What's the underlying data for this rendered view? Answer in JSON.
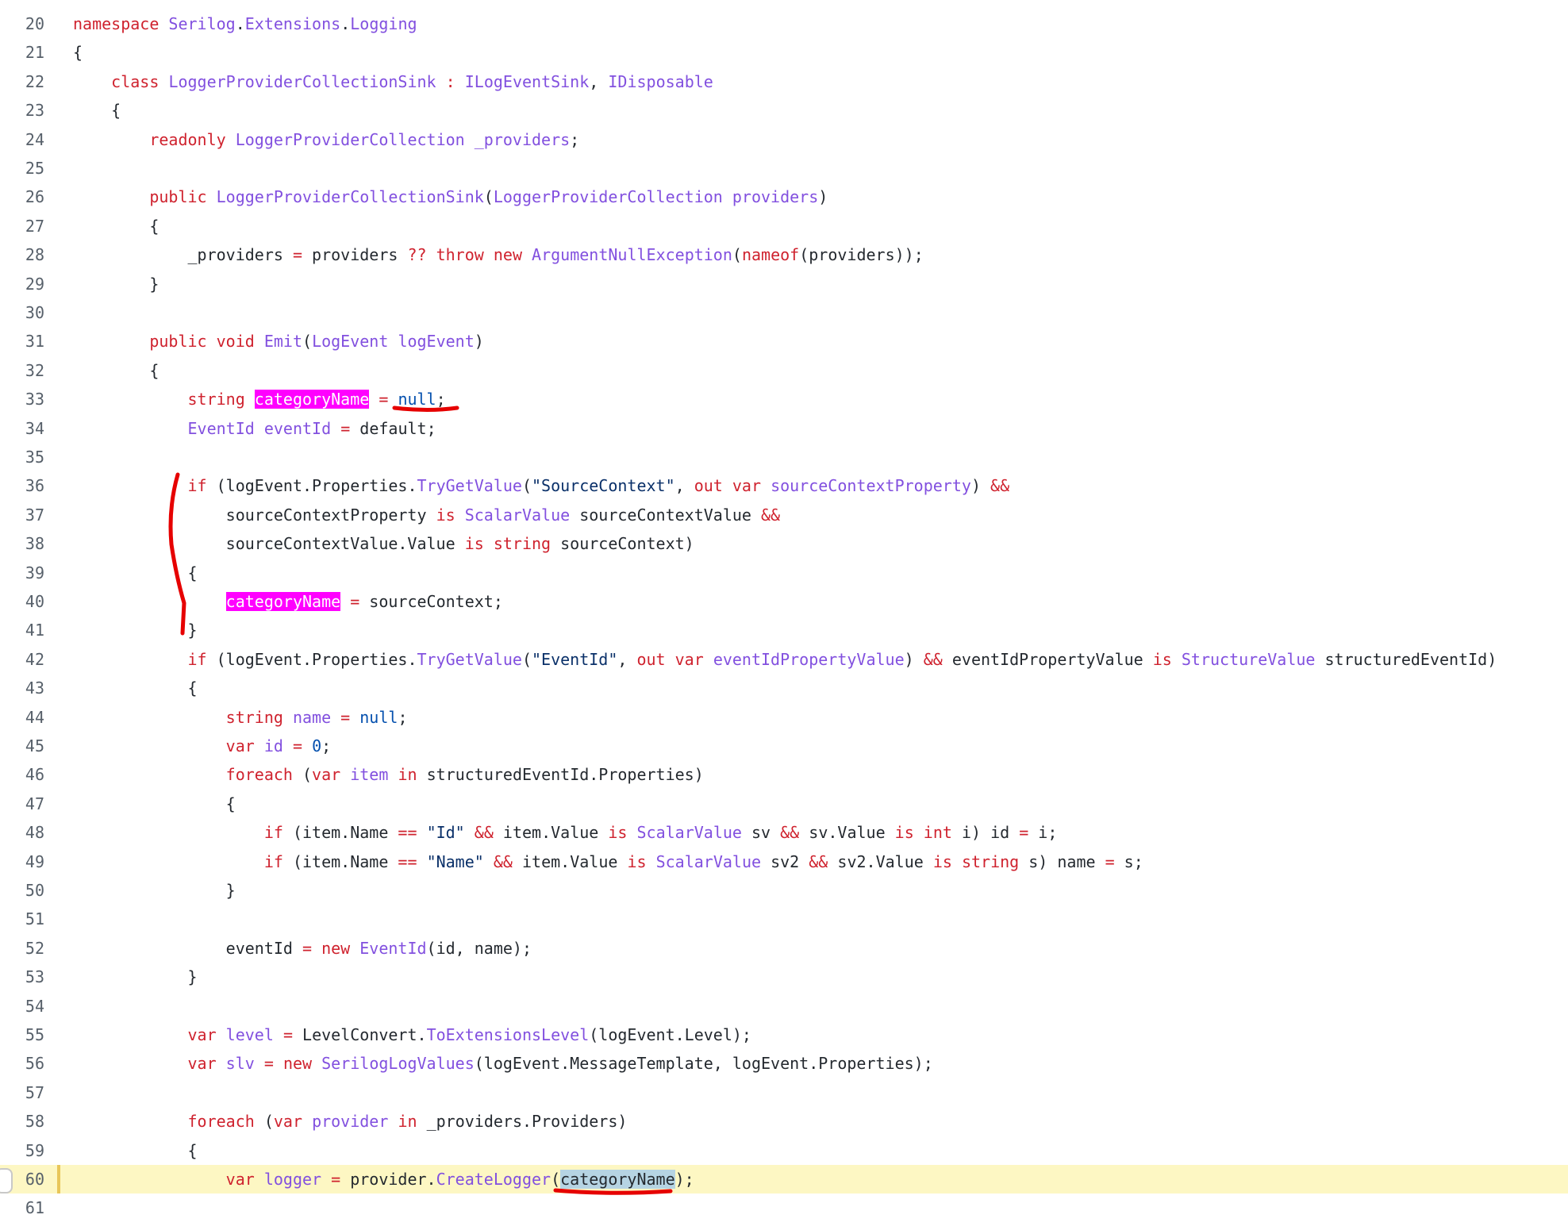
{
  "editor": {
    "active_line": "60",
    "colors": {
      "keyword": "#cf222e",
      "type": "#8250df",
      "string": "#0a3069",
      "literal": "#0550ae",
      "highlight": "#ff00ff",
      "active_line_bg": "#fdf7c3",
      "annotation": "#e60000"
    },
    "lines": [
      {
        "n": "20",
        "t": [
          [
            "kw",
            "namespace"
          ],
          [
            "p",
            " "
          ],
          [
            "ty",
            "Serilog"
          ],
          [
            "p",
            "."
          ],
          [
            "ty",
            "Extensions"
          ],
          [
            "p",
            "."
          ],
          [
            "ty",
            "Logging"
          ]
        ]
      },
      {
        "n": "21",
        "t": [
          [
            "p",
            "{"
          ]
        ]
      },
      {
        "n": "22",
        "t": [
          [
            "p",
            "    "
          ],
          [
            "kw",
            "class"
          ],
          [
            "p",
            " "
          ],
          [
            "ty",
            "LoggerProviderCollectionSink"
          ],
          [
            "p",
            " "
          ],
          [
            "op",
            ":"
          ],
          [
            "p",
            " "
          ],
          [
            "ty",
            "ILogEventSink"
          ],
          [
            "p",
            ", "
          ],
          [
            "ty",
            "IDisposable"
          ]
        ]
      },
      {
        "n": "23",
        "t": [
          [
            "p",
            "    {"
          ]
        ]
      },
      {
        "n": "24",
        "t": [
          [
            "p",
            "        "
          ],
          [
            "kw",
            "readonly"
          ],
          [
            "p",
            " "
          ],
          [
            "ty",
            "LoggerProviderCollection"
          ],
          [
            "p",
            " "
          ],
          [
            "ty",
            "_providers"
          ],
          [
            "p",
            ";"
          ]
        ]
      },
      {
        "n": "25",
        "t": []
      },
      {
        "n": "26",
        "t": [
          [
            "p",
            "        "
          ],
          [
            "kw",
            "public"
          ],
          [
            "p",
            " "
          ],
          [
            "ty",
            "LoggerProviderCollectionSink"
          ],
          [
            "p",
            "("
          ],
          [
            "ty",
            "LoggerProviderCollection"
          ],
          [
            "p",
            " "
          ],
          [
            "ty",
            "providers"
          ],
          [
            "p",
            ")"
          ]
        ]
      },
      {
        "n": "27",
        "t": [
          [
            "p",
            "        {"
          ]
        ]
      },
      {
        "n": "28",
        "t": [
          [
            "p",
            "            _providers "
          ],
          [
            "op",
            "="
          ],
          [
            "p",
            " providers "
          ],
          [
            "op",
            "??"
          ],
          [
            "p",
            " "
          ],
          [
            "kw",
            "throw"
          ],
          [
            "p",
            " "
          ],
          [
            "kw",
            "new"
          ],
          [
            "p",
            " "
          ],
          [
            "ty",
            "ArgumentNullException"
          ],
          [
            "p",
            "("
          ],
          [
            "kw",
            "nameof"
          ],
          [
            "p",
            "(providers));"
          ]
        ]
      },
      {
        "n": "29",
        "t": [
          [
            "p",
            "        }"
          ]
        ]
      },
      {
        "n": "30",
        "t": []
      },
      {
        "n": "31",
        "t": [
          [
            "p",
            "        "
          ],
          [
            "kw",
            "public"
          ],
          [
            "p",
            " "
          ],
          [
            "kw",
            "void"
          ],
          [
            "p",
            " "
          ],
          [
            "ty",
            "Emit"
          ],
          [
            "p",
            "("
          ],
          [
            "ty",
            "LogEvent"
          ],
          [
            "p",
            " "
          ],
          [
            "ty",
            "logEvent"
          ],
          [
            "p",
            ")"
          ]
        ]
      },
      {
        "n": "32",
        "t": [
          [
            "p",
            "        {"
          ]
        ]
      },
      {
        "n": "33",
        "t": [
          [
            "p",
            "            "
          ],
          [
            "kw",
            "string"
          ],
          [
            "p",
            " "
          ],
          [
            "hl",
            "categoryName"
          ],
          [
            "p",
            " "
          ],
          [
            "op",
            "="
          ],
          [
            "p",
            " "
          ],
          [
            "lit",
            "null"
          ],
          [
            "p",
            ";"
          ]
        ]
      },
      {
        "n": "34",
        "t": [
          [
            "p",
            "            "
          ],
          [
            "ty",
            "EventId"
          ],
          [
            "p",
            " "
          ],
          [
            "ty",
            "eventId"
          ],
          [
            "p",
            " "
          ],
          [
            "op",
            "="
          ],
          [
            "p",
            " default;"
          ]
        ]
      },
      {
        "n": "35",
        "t": []
      },
      {
        "n": "36",
        "t": [
          [
            "p",
            "            "
          ],
          [
            "kw",
            "if"
          ],
          [
            "p",
            " (logEvent.Properties."
          ],
          [
            "ty",
            "TryGetValue"
          ],
          [
            "p",
            "("
          ],
          [
            "st",
            "\"SourceContext\""
          ],
          [
            "p",
            ", "
          ],
          [
            "kw",
            "out"
          ],
          [
            "p",
            " "
          ],
          [
            "kw",
            "var"
          ],
          [
            "p",
            " "
          ],
          [
            "ty",
            "sourceContextProperty"
          ],
          [
            "p",
            ") "
          ],
          [
            "op",
            "&&"
          ]
        ]
      },
      {
        "n": "37",
        "t": [
          [
            "p",
            "                sourceContextProperty "
          ],
          [
            "kw",
            "is"
          ],
          [
            "p",
            " "
          ],
          [
            "ty",
            "ScalarValue"
          ],
          [
            "p",
            " sourceContextValue "
          ],
          [
            "op",
            "&&"
          ]
        ]
      },
      {
        "n": "38",
        "t": [
          [
            "p",
            "                sourceContextValue.Value "
          ],
          [
            "kw",
            "is"
          ],
          [
            "p",
            " "
          ],
          [
            "kw",
            "string"
          ],
          [
            "p",
            " sourceContext)"
          ]
        ]
      },
      {
        "n": "39",
        "t": [
          [
            "p",
            "            {"
          ]
        ]
      },
      {
        "n": "40",
        "t": [
          [
            "p",
            "                "
          ],
          [
            "hl",
            "categoryName"
          ],
          [
            "p",
            " "
          ],
          [
            "op",
            "="
          ],
          [
            "p",
            " sourceContext;"
          ]
        ]
      },
      {
        "n": "41",
        "t": [
          [
            "p",
            "            }"
          ]
        ]
      },
      {
        "n": "42",
        "t": [
          [
            "p",
            "            "
          ],
          [
            "kw",
            "if"
          ],
          [
            "p",
            " (logEvent.Properties."
          ],
          [
            "ty",
            "TryGetValue"
          ],
          [
            "p",
            "("
          ],
          [
            "st",
            "\"EventId\""
          ],
          [
            "p",
            ", "
          ],
          [
            "kw",
            "out"
          ],
          [
            "p",
            " "
          ],
          [
            "kw",
            "var"
          ],
          [
            "p",
            " "
          ],
          [
            "ty",
            "eventIdPropertyValue"
          ],
          [
            "p",
            ") "
          ],
          [
            "op",
            "&&"
          ],
          [
            "p",
            " eventIdPropertyValue "
          ],
          [
            "kw",
            "is"
          ],
          [
            "p",
            " "
          ],
          [
            "ty",
            "StructureValue"
          ],
          [
            "p",
            " structuredEventId)"
          ]
        ]
      },
      {
        "n": "43",
        "t": [
          [
            "p",
            "            {"
          ]
        ]
      },
      {
        "n": "44",
        "t": [
          [
            "p",
            "                "
          ],
          [
            "kw",
            "string"
          ],
          [
            "p",
            " "
          ],
          [
            "ty",
            "name"
          ],
          [
            "p",
            " "
          ],
          [
            "op",
            "="
          ],
          [
            "p",
            " "
          ],
          [
            "lit",
            "null"
          ],
          [
            "p",
            ";"
          ]
        ]
      },
      {
        "n": "45",
        "t": [
          [
            "p",
            "                "
          ],
          [
            "kw",
            "var"
          ],
          [
            "p",
            " "
          ],
          [
            "ty",
            "id"
          ],
          [
            "p",
            " "
          ],
          [
            "op",
            "="
          ],
          [
            "p",
            " "
          ],
          [
            "lit",
            "0"
          ],
          [
            "p",
            ";"
          ]
        ]
      },
      {
        "n": "46",
        "t": [
          [
            "p",
            "                "
          ],
          [
            "kw",
            "foreach"
          ],
          [
            "p",
            " ("
          ],
          [
            "kw",
            "var"
          ],
          [
            "p",
            " "
          ],
          [
            "ty",
            "item"
          ],
          [
            "p",
            " "
          ],
          [
            "kw",
            "in"
          ],
          [
            "p",
            " structuredEventId.Properties)"
          ]
        ]
      },
      {
        "n": "47",
        "t": [
          [
            "p",
            "                {"
          ]
        ]
      },
      {
        "n": "48",
        "t": [
          [
            "p",
            "                    "
          ],
          [
            "kw",
            "if"
          ],
          [
            "p",
            " (item.Name "
          ],
          [
            "op",
            "=="
          ],
          [
            "p",
            " "
          ],
          [
            "st",
            "\"Id\""
          ],
          [
            "p",
            " "
          ],
          [
            "op",
            "&&"
          ],
          [
            "p",
            " item.Value "
          ],
          [
            "kw",
            "is"
          ],
          [
            "p",
            " "
          ],
          [
            "ty",
            "ScalarValue"
          ],
          [
            "p",
            " sv "
          ],
          [
            "op",
            "&&"
          ],
          [
            "p",
            " sv.Value "
          ],
          [
            "kw",
            "is"
          ],
          [
            "p",
            " "
          ],
          [
            "kw",
            "int"
          ],
          [
            "p",
            " i) id "
          ],
          [
            "op",
            "="
          ],
          [
            "p",
            " i;"
          ]
        ]
      },
      {
        "n": "49",
        "t": [
          [
            "p",
            "                    "
          ],
          [
            "kw",
            "if"
          ],
          [
            "p",
            " (item.Name "
          ],
          [
            "op",
            "=="
          ],
          [
            "p",
            " "
          ],
          [
            "st",
            "\"Name\""
          ],
          [
            "p",
            " "
          ],
          [
            "op",
            "&&"
          ],
          [
            "p",
            " item.Value "
          ],
          [
            "kw",
            "is"
          ],
          [
            "p",
            " "
          ],
          [
            "ty",
            "ScalarValue"
          ],
          [
            "p",
            " sv2 "
          ],
          [
            "op",
            "&&"
          ],
          [
            "p",
            " sv2.Value "
          ],
          [
            "kw",
            "is"
          ],
          [
            "p",
            " "
          ],
          [
            "kw",
            "string"
          ],
          [
            "p",
            " s) name "
          ],
          [
            "op",
            "="
          ],
          [
            "p",
            " s;"
          ]
        ]
      },
      {
        "n": "50",
        "t": [
          [
            "p",
            "                }"
          ]
        ]
      },
      {
        "n": "51",
        "t": []
      },
      {
        "n": "52",
        "t": [
          [
            "p",
            "                eventId "
          ],
          [
            "op",
            "="
          ],
          [
            "p",
            " "
          ],
          [
            "kw",
            "new"
          ],
          [
            "p",
            " "
          ],
          [
            "ty",
            "EventId"
          ],
          [
            "p",
            "(id, name);"
          ]
        ]
      },
      {
        "n": "53",
        "t": [
          [
            "p",
            "            }"
          ]
        ]
      },
      {
        "n": "54",
        "t": []
      },
      {
        "n": "55",
        "t": [
          [
            "p",
            "            "
          ],
          [
            "kw",
            "var"
          ],
          [
            "p",
            " "
          ],
          [
            "ty",
            "level"
          ],
          [
            "p",
            " "
          ],
          [
            "op",
            "="
          ],
          [
            "p",
            " LevelConvert."
          ],
          [
            "ty",
            "ToExtensionsLevel"
          ],
          [
            "p",
            "(logEvent.Level);"
          ]
        ]
      },
      {
        "n": "56",
        "t": [
          [
            "p",
            "            "
          ],
          [
            "kw",
            "var"
          ],
          [
            "p",
            " "
          ],
          [
            "ty",
            "slv"
          ],
          [
            "p",
            " "
          ],
          [
            "op",
            "="
          ],
          [
            "p",
            " "
          ],
          [
            "kw",
            "new"
          ],
          [
            "p",
            " "
          ],
          [
            "ty",
            "SerilogLogValues"
          ],
          [
            "p",
            "(logEvent.MessageTemplate, logEvent.Properties);"
          ]
        ]
      },
      {
        "n": "57",
        "t": []
      },
      {
        "n": "58",
        "t": [
          [
            "p",
            "            "
          ],
          [
            "kw",
            "foreach"
          ],
          [
            "p",
            " ("
          ],
          [
            "kw",
            "var"
          ],
          [
            "p",
            " "
          ],
          [
            "ty",
            "provider"
          ],
          [
            "p",
            " "
          ],
          [
            "kw",
            "in"
          ],
          [
            "p",
            " _providers.Providers)"
          ]
        ]
      },
      {
        "n": "59",
        "t": [
          [
            "p",
            "            {"
          ]
        ]
      },
      {
        "n": "60",
        "t": [
          [
            "p",
            "                "
          ],
          [
            "kw",
            "var"
          ],
          [
            "p",
            " "
          ],
          [
            "ty",
            "logger"
          ],
          [
            "p",
            " "
          ],
          [
            "op",
            "="
          ],
          [
            "p",
            " provider."
          ],
          [
            "ty",
            "CreateLogger"
          ],
          [
            "p",
            "("
          ],
          [
            "sel",
            "categoryName"
          ],
          [
            "p",
            ");"
          ]
        ]
      },
      {
        "n": "61",
        "t": []
      }
    ]
  }
}
